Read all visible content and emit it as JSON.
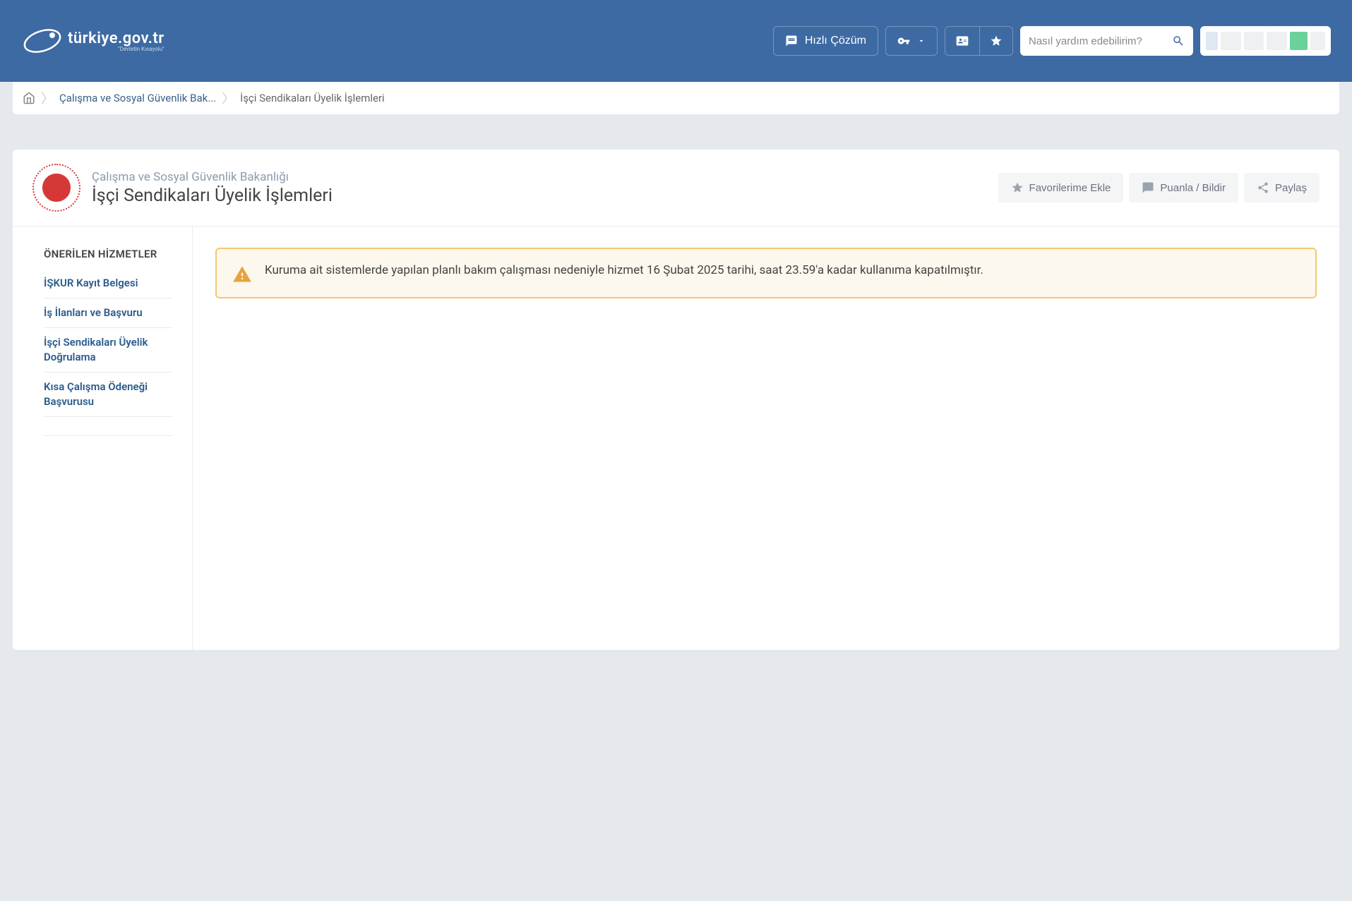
{
  "header": {
    "logo_text": "türkiye.gov.tr",
    "logo_sub": "\"Devletin Kısayolu\"",
    "quick_solution": "Hızlı Çözüm"
  },
  "search": {
    "placeholder": "Nasıl yardım edebilirim?"
  },
  "breadcrumb": {
    "ministry": "Çalışma ve Sosyal Güvenlik Bak...",
    "current": "İşçi Sendikaları Üyelik İşlemleri"
  },
  "card": {
    "subtitle": "Çalışma ve Sosyal Güvenlik Bakanlığı",
    "title": "İşçi Sendikaları Üyelik İşlemleri",
    "actions": {
      "favorite": "Favorilerime Ekle",
      "rate": "Puanla / Bildir",
      "share": "Paylaş"
    }
  },
  "sidebar": {
    "heading": "ÖNERİLEN HİZMETLER",
    "items": [
      "İŞKUR Kayıt Belgesi",
      "İş İlanları ve Başvuru",
      "İşçi Sendikaları Üyelik Doğrulama",
      "Kısa Çalışma Ödeneği Başvurusu"
    ]
  },
  "alert": {
    "message": "Kuruma ait sistemlerde yapılan planlı bakım çalışması nedeniyle hizmet 16 Şubat 2025 tarihi, saat 23.59'a kadar kullanıma kapatılmıştır."
  }
}
